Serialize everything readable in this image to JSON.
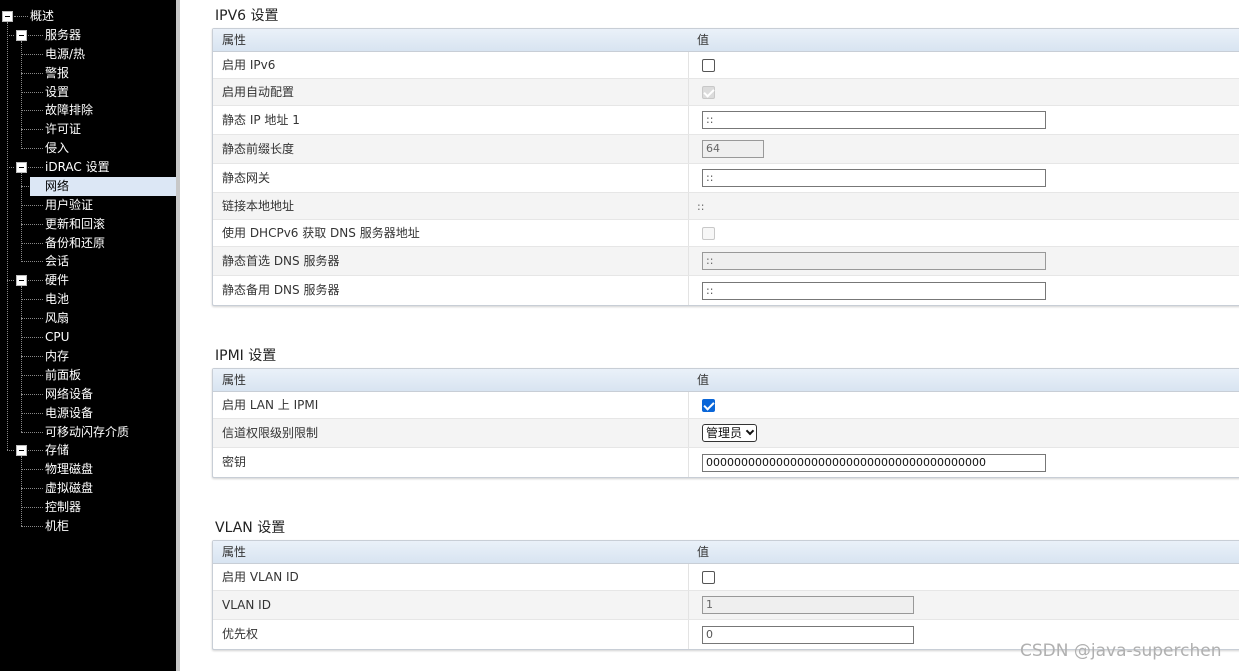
{
  "sidebar": {
    "root": "概述",
    "groups": [
      {
        "label": "服务器",
        "items": [
          "电源/热",
          "警报",
          "设置",
          "故障排除",
          "许可证",
          "侵入"
        ]
      },
      {
        "label": "iDRAC 设置",
        "items": [
          "网络",
          "用户验证",
          "更新和回滚",
          "备份和还原",
          "会话"
        ]
      },
      {
        "label": "硬件",
        "items": [
          "电池",
          "风扇",
          "CPU",
          "内存",
          "前面板",
          "网络设备",
          "电源设备",
          "可移动闪存介质"
        ]
      },
      {
        "label": "存储",
        "items": [
          "物理磁盘",
          "虚拟磁盘",
          "控制器",
          "机柜"
        ]
      }
    ],
    "selected": "网络"
  },
  "ipv6": {
    "title": "IPV6 设置",
    "col_attr": "属性",
    "col_value": "值",
    "rows": [
      {
        "label": "启用 IPv6",
        "type": "checkbox",
        "checked": false
      },
      {
        "label": "启用自动配置",
        "type": "checkbox-disabled",
        "checked": true
      },
      {
        "label": "静态 IP 地址 1",
        "type": "text",
        "value": "::"
      },
      {
        "label": "静态前缀长度",
        "type": "text-readonly",
        "value": "64"
      },
      {
        "label": "静态网关",
        "type": "text",
        "value": "::"
      },
      {
        "label": "链接本地地址",
        "type": "plain",
        "value": "::"
      },
      {
        "label": "使用 DHCPv6 获取 DNS 服务器地址",
        "type": "checkbox-disabled",
        "checked": false
      },
      {
        "label": "静态首选 DNS 服务器",
        "type": "text-readonly",
        "value": "::"
      },
      {
        "label": "静态备用 DNS 服务器",
        "type": "text",
        "value": "::"
      }
    ]
  },
  "ipmi": {
    "title": "IPMI 设置",
    "col_attr": "属性",
    "col_value": "值",
    "rows": [
      {
        "label": "启用 LAN 上 IPMI",
        "type": "checkbox",
        "checked": true
      },
      {
        "label": "信道权限级别限制",
        "type": "select",
        "value": "管理员"
      },
      {
        "label": "密钥",
        "type": "text",
        "value": "0000000000000000000000000000000000000000"
      }
    ]
  },
  "vlan": {
    "title": "VLAN 设置",
    "col_attr": "属性",
    "col_value": "值",
    "rows": [
      {
        "label": "启用 VLAN ID",
        "type": "checkbox",
        "checked": false
      },
      {
        "label": "VLAN ID",
        "type": "text-readonly",
        "value": "1"
      },
      {
        "label": "优先权",
        "type": "text",
        "value": "0"
      }
    ]
  },
  "watermark": "CSDN @java-superchen",
  "colors": {
    "sidebar_bg": "#000000",
    "selected_bg": "#dce7f5",
    "checkbox_accent": "#0a66d8"
  },
  "icons": {
    "tree_toggle": "minus-box-icon"
  }
}
